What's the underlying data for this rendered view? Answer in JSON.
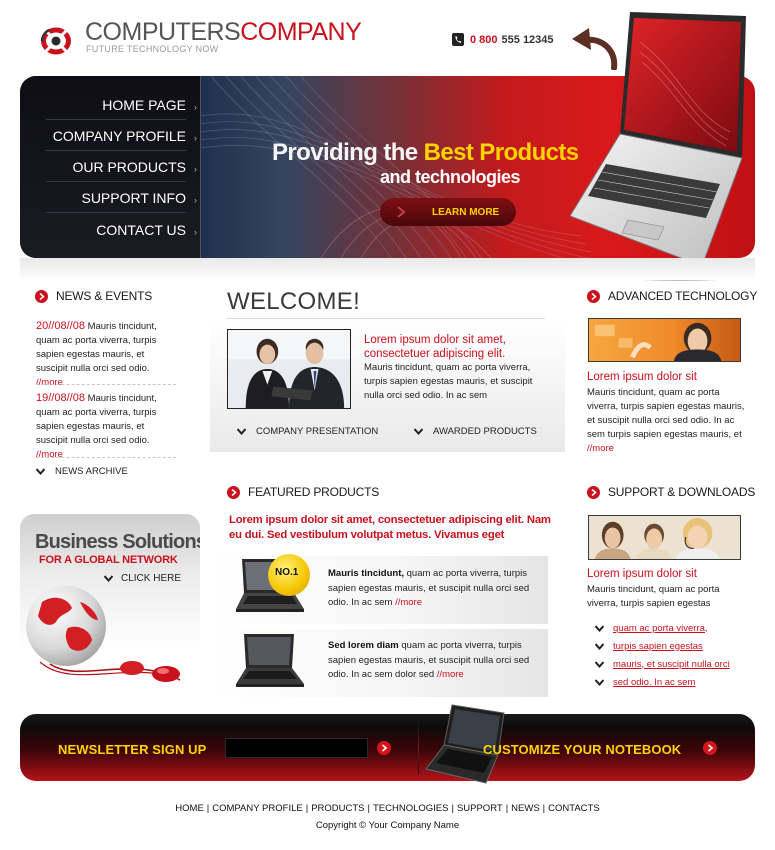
{
  "brand": {
    "name_part1": "COMPUTERS",
    "name_part2": "COMPANY",
    "tagline": "FUTURE TECHNOLOGY NOW",
    "phone_prefix": "0 800",
    "phone_number": "555 12345"
  },
  "nav": {
    "items": [
      {
        "label": "HOME PAGE"
      },
      {
        "label": "COMPANY PROFILE"
      },
      {
        "label": "OUR PRODUCTS"
      },
      {
        "label": "SUPPORT INFO"
      },
      {
        "label": "CONTACT US"
      }
    ]
  },
  "hero": {
    "line1_plain": "Providing the ",
    "line1_highlight": "Best Products",
    "line2": "and technologies",
    "cta_label": "LEARN MORE"
  },
  "news": {
    "heading": "NEWS & EVENTS",
    "items": [
      {
        "date": "20//08//08",
        "text": " Mauris tincidunt, quam ac porta viverra, turpis sapien egestas mauris, et suscipit nulla orci sed odio. ",
        "more": "//more"
      },
      {
        "date": "19//08//08",
        "text": " Mauris tincidunt, quam ac porta viverra, turpis sapien egestas mauris, et suscipit nulla orci sed odio. ",
        "more": "//more"
      }
    ],
    "archive_label": "NEWS ARCHIVE"
  },
  "business": {
    "title": "Business Solutions",
    "subtitle": "FOR A GLOBAL NETWORK",
    "click_label": "CLICK HERE"
  },
  "welcome": {
    "title": "WELCOME!",
    "lead": "Lorem ipsum dolor sit amet, consectetuer adipiscing elit.",
    "body": "Mauris tincidunt, quam ac porta viverra, turpis sapien egestas mauris, et suscipit nulla orci sed odio. In ac sem",
    "link_presentation": "COMPANY PRESENTATION",
    "link_awarded": "AWARDED PRODUCTS"
  },
  "featured": {
    "heading": "FEATURED PRODUCTS",
    "lead": "Lorem ipsum dolor sit amet, consectetuer adipiscing elit. Nam eu dui. Sed vestibulum volutpat metus. Vivamus eget",
    "badge": "NO.1",
    "products": [
      {
        "title": "Mauris tincidunt,",
        "text": " quam ac porta viverra, turpis sapien egestas mauris, et suscipit nulla orci sed odio. In ac sem ",
        "more": "//more"
      },
      {
        "title": "Sed lorem diam",
        "text": " quam ac porta viverra, turpis sapien egestas mauris, et suscipit nulla orci sed odio. In ac sem dolor sed ",
        "more": "//more"
      }
    ]
  },
  "advanced": {
    "heading": "ADVANCED TECHNOLOGY",
    "lead": "Lorem ipsum dolor sit",
    "body": "Mauris tincidunt, quam ac porta viverra, turpis sapien egestas mauris, et suscipit nulla orci sed odio. In ac sem  turpis sapien egestas mauris, et ",
    "more": "//more"
  },
  "support": {
    "heading": "SUPPORT & DOWNLOADS",
    "lead": "Lorem ipsum dolor sit",
    "body": "Mauris tincidunt, quam ac porta viverra, turpis sapien egestas",
    "links": [
      {
        "label": "quam ac porta viverra,"
      },
      {
        "label": "turpis sapien egestas"
      },
      {
        "label": "mauris, et suscipit nulla orci"
      },
      {
        "label": "sed odio. In ac sem "
      }
    ]
  },
  "newsletter": {
    "label": "NEWSLETTER SIGN UP",
    "input_value": ""
  },
  "customize": {
    "label": "CUSTOMIZE YOUR NOTEBOOK"
  },
  "footer": {
    "links": [
      {
        "label": "HOME"
      },
      {
        "label": "COMPANY PROFILE"
      },
      {
        "label": "PRODUCTS"
      },
      {
        "label": "TECHNOLOGIES"
      },
      {
        "label": "SUPPORT"
      },
      {
        "label": "NEWS"
      },
      {
        "label": "CONTACTS"
      }
    ],
    "separator": "|",
    "copyright": "Copyright © Your Company Name"
  },
  "colors": {
    "brand_red": "#c8111d",
    "accent_yellow": "#ffd200",
    "nav_dark": "#111218",
    "text_dark": "#222222"
  },
  "icons": [
    "logo-icon",
    "phone-icon",
    "curved-arrow-icon",
    "chevron-right-icon",
    "red-bullet-icon",
    "check-icon",
    "circle-arrow-icon",
    "laptop-image",
    "globe-image"
  ]
}
